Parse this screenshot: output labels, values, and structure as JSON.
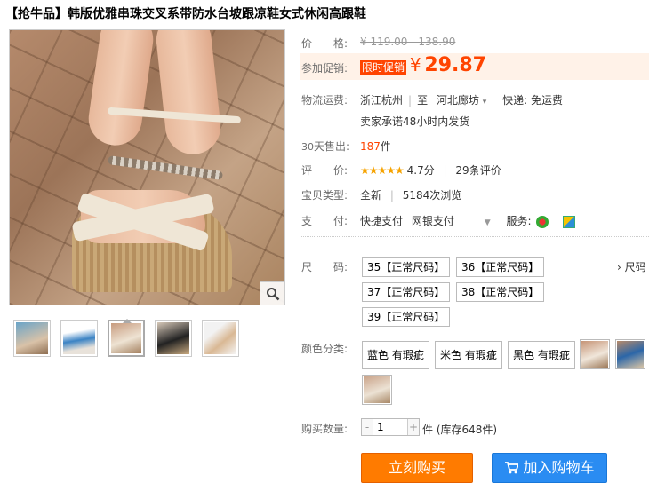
{
  "title": "【抢牛品】韩版优雅串珠交叉系带防水台坡跟凉鞋女式休闲高跟鞋",
  "price": {
    "label": "价　　格:",
    "original": "¥ 119.00 - 138.90"
  },
  "promo": {
    "label": "参加促销:",
    "tag": "限时促销",
    "currency": "¥",
    "amount": "29.87"
  },
  "shipping": {
    "label": "物流运费:",
    "from": "浙江杭州",
    "to_prefix": "至",
    "to": "河北廊坊",
    "fee": "快递: 免运费",
    "promise": "卖家承诺48小时内发货"
  },
  "sales": {
    "label_days": "30",
    "label_text": "天售出:",
    "count": "187",
    "unit": "件"
  },
  "rating": {
    "label": "评　　价:",
    "stars": "★★★★★",
    "score": "4.7分",
    "reviews": "29条评价"
  },
  "item_type": {
    "label": "宝贝类型:",
    "condition": "全新",
    "views": "5184次浏览"
  },
  "payment": {
    "label": "支　　付:",
    "express": "快捷支付",
    "bank": "网银支付",
    "services_label": "服务:"
  },
  "sizes": {
    "label": "尺　　码:",
    "more": "› 尺码",
    "options": [
      "35【正常尺码】",
      "36【正常尺码】",
      "37【正常尺码】",
      "38【正常尺码】",
      "39【正常尺码】"
    ]
  },
  "colors": {
    "label": "颜色分类:",
    "options": [
      "蓝色 有瑕疵",
      "米色 有瑕疵",
      "黑色 有瑕疵"
    ]
  },
  "quantity": {
    "label": "购买数量:",
    "minus": "-",
    "value": "1",
    "plus": "+",
    "unit": "件",
    "stock": "(库存648件)"
  },
  "buttons": {
    "buy": "立刻购买",
    "cart": "加入购物车"
  },
  "icons": {
    "zoom": "magnifier-icon",
    "cart": "cart-icon",
    "service1": "tmall-service-icon",
    "service2": "guarantee-icon",
    "dropdown": "chevron-down-icon"
  },
  "colors_theme": {
    "accent": "#ff4400",
    "buy_button": "#ff7b00",
    "cart_button": "#2a8cf2",
    "stars": "#f6a300"
  }
}
